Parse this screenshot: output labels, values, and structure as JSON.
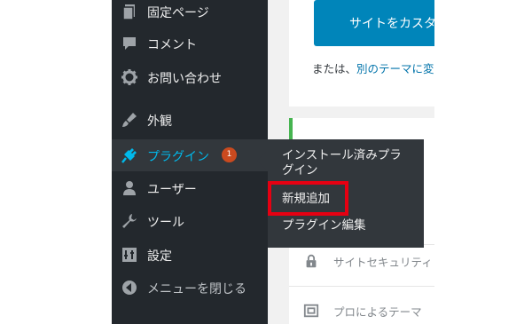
{
  "sidebar": {
    "items": [
      {
        "label": "固定ページ",
        "icon": "pages-icon"
      },
      {
        "label": "コメント",
        "icon": "comment-icon"
      },
      {
        "label": "お問い合わせ",
        "icon": "gear-icon"
      },
      {
        "label": "外観",
        "icon": "paintbrush-icon"
      },
      {
        "label": "プラグイン",
        "icon": "plugin-icon",
        "badge": "1",
        "active": true
      },
      {
        "label": "ユーザー",
        "icon": "user-icon"
      },
      {
        "label": "ツール",
        "icon": "wrench-icon"
      },
      {
        "label": "設定",
        "icon": "settings-icon"
      },
      {
        "label": "メニューを閉じる",
        "icon": "collapse-icon"
      }
    ]
  },
  "submenu": {
    "installed_line1": "インストール済みプラ",
    "installed_line2": "グイン",
    "add_new": "新規追加",
    "editor": "プラグイン編集"
  },
  "content": {
    "customize_button": "サイトをカスタマイズ",
    "or_text": "または、",
    "or_link": "別のテーマに変更",
    "security_text": "サイトセキュリティ",
    "pro_theme_text": "プロによるテーマ"
  },
  "colors": {
    "sidebar_bg": "#23282d",
    "active_bg": "#32373c",
    "active_text": "#00b9eb",
    "badge_bg": "#ca4a1f",
    "button_bg": "#0085ba",
    "highlight": "#e60012"
  }
}
